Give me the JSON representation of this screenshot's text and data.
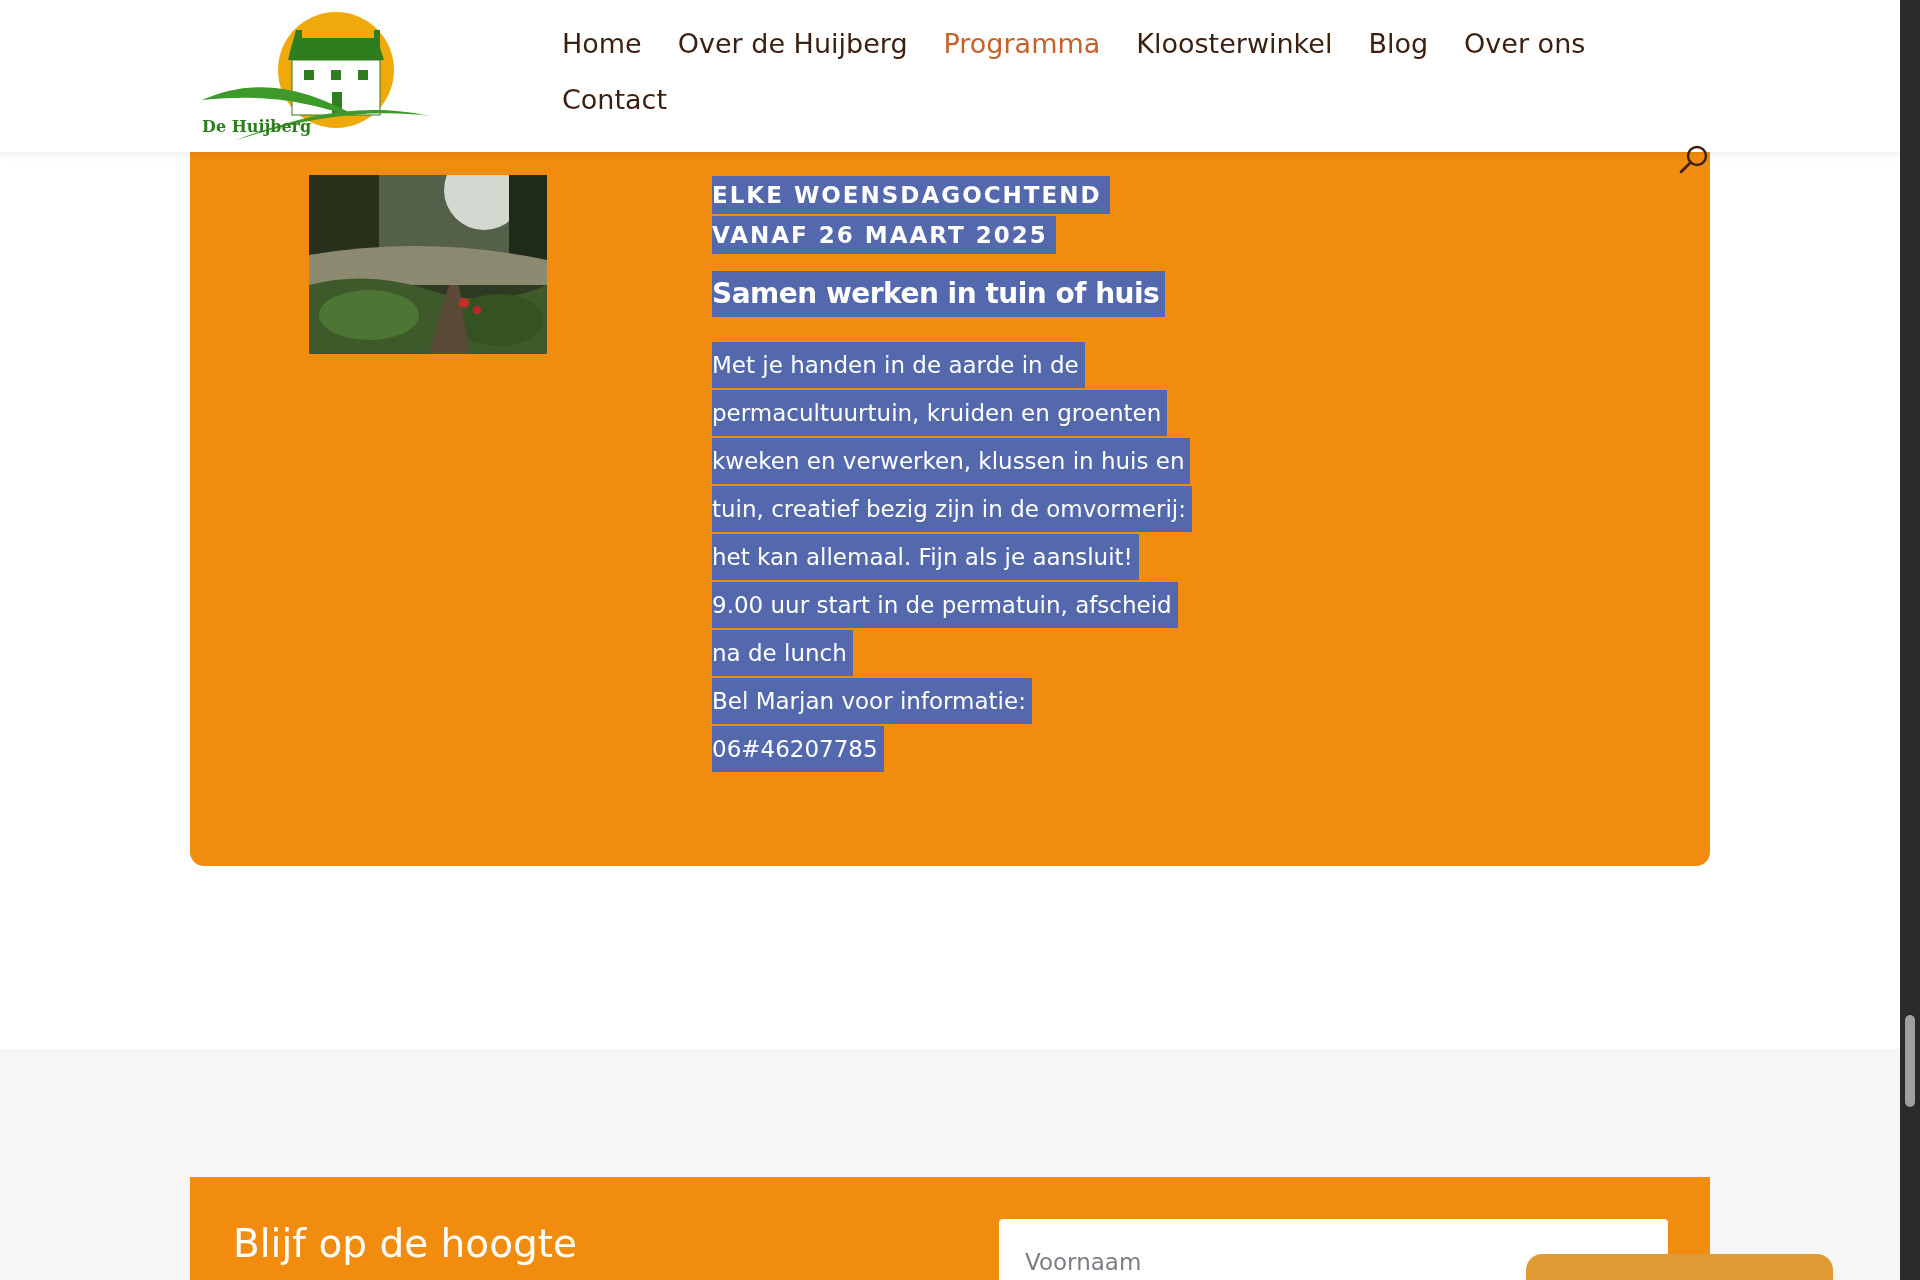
{
  "logo": {
    "text": "De Huijberg"
  },
  "nav": [
    {
      "label": "Home",
      "selected": false
    },
    {
      "label": "Over de Huijberg",
      "selected": false
    },
    {
      "label": "Programma",
      "selected": true
    },
    {
      "label": "Kloosterwinkel",
      "selected": false
    },
    {
      "label": "Blog",
      "selected": false
    },
    {
      "label": "Over ons",
      "selected": false
    },
    {
      "label": "Contact",
      "selected": false
    }
  ],
  "event": {
    "text_selected": true,
    "schedule": [
      "ELKE WOENSDAGOCHTEND",
      "VANAF 26 MAART 2025"
    ],
    "title": "Samen werken in tuin of huis",
    "body": [
      "Met je handen in de aarde in de permacultuurtuin, kruiden en groenten kweken en verwerken, klussen in huis en tuin, creatief bezig zijn in de omvormerij: het kan allemaal. Fijn als je aansluit!",
      "9.00 uur start in de permatuin, afscheid na de lunch",
      "Bel Marjan voor informatie:",
      "06#46207785"
    ]
  },
  "newsletter": {
    "title": "Blijf op de hoogte",
    "first_name": {
      "placeholder": "Voornaam"
    }
  }
}
